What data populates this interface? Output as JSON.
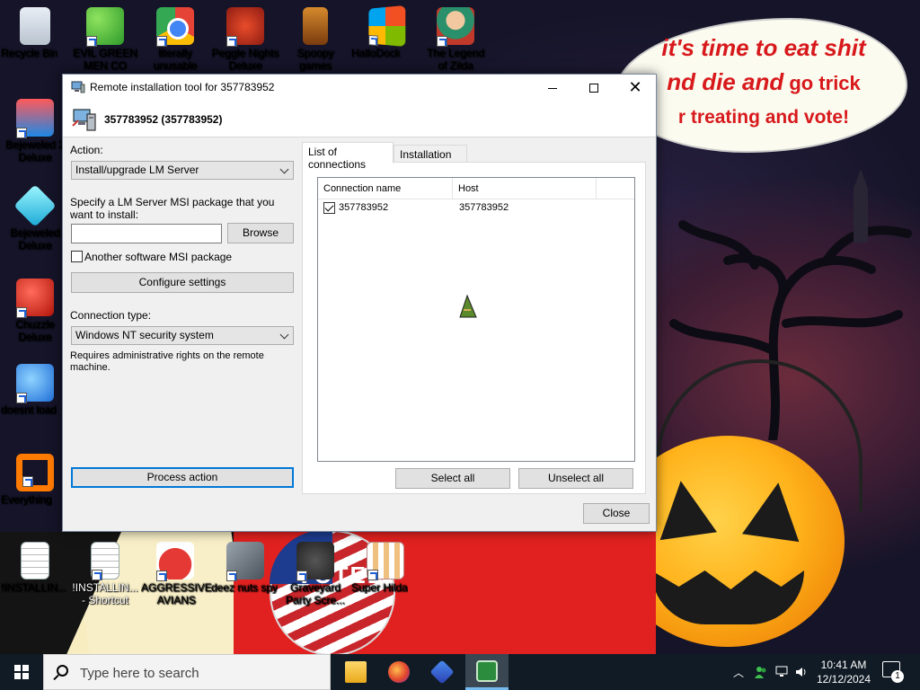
{
  "desktop": {
    "speech_bubble": {
      "line1": "it's time to eat shit",
      "line2_a": "nd die and",
      "line2_b": " go trick",
      "line3": "r treating and vote!"
    },
    "icons_top": [
      {
        "label": "Recycle Bin",
        "icon": "recycle-bin-icon"
      },
      {
        "label": "EVIL GREEN MEN CO",
        "icon": "msn-people-icon"
      },
      {
        "label": "literally unusable",
        "icon": "chrome-icon"
      },
      {
        "label": "Peggle Nights Deluxe",
        "icon": "peggle-icon"
      },
      {
        "label": "Spoopy games",
        "icon": "spoopy-folder-icon"
      },
      {
        "label": "HalloDock",
        "icon": "windows-logo-icon"
      },
      {
        "label": "The Legend of Zilda",
        "icon": "zilda-icon"
      }
    ],
    "icons_left": [
      {
        "label": "Bejeweled 2 Deluxe",
        "icon": "bejeweled-2-icon"
      },
      {
        "label": "Bejeweled Deluxe",
        "icon": "bejeweled-icon"
      },
      {
        "label": "Chuzzle Deluxe",
        "icon": "chuzzle-icon"
      },
      {
        "label": "doesnt load",
        "icon": "thunderbird-icon"
      },
      {
        "label": "Everything",
        "icon": "everything-search-icon"
      }
    ],
    "icons_bottom": [
      {
        "label": "!INSTALLIN...",
        "icon": "text-document-icon"
      },
      {
        "label": "!INSTALLIN... - Shortcut",
        "icon": "text-document-shortcut-icon"
      },
      {
        "label": "AGGRESSIVE AVIANS",
        "icon": "angry-bird-icon"
      },
      {
        "label": "deez nuts spy",
        "icon": "stacked-windows-icon"
      },
      {
        "label": "Graveyard Party Scre...",
        "icon": "graveyard-icon"
      },
      {
        "label": "Super Hilda",
        "icon": "pixel-dog-icon"
      }
    ],
    "background_text": "VOTED"
  },
  "dialog": {
    "title": "Remote installation tool for 357783952",
    "header": "357783952 (357783952)",
    "action_label": "Action:",
    "action_value": "Install/upgrade LM Server",
    "msi_label": "Specify a LM Server MSI package that you want to install:",
    "msi_path_value": "",
    "browse_label": "Browse",
    "another_msi_label": "Another software MSI package",
    "another_msi_checked": false,
    "configure_label": "Configure settings",
    "connection_type_label": "Connection type:",
    "connection_type_value": "Windows NT security system",
    "requires_note": "Requires administrative rights on the remote machine.",
    "process_label": "Process action",
    "tabs": [
      {
        "label": "List of connections",
        "active": true
      },
      {
        "label": "Installation log",
        "active": false
      }
    ],
    "columns": [
      "Connection name",
      "Host"
    ],
    "rows": [
      {
        "checked": true,
        "connection_name": "357783952",
        "host": "357783952"
      }
    ],
    "select_all_label": "Select all",
    "unselect_all_label": "Unselect all",
    "close_label": "Close"
  },
  "taskbar": {
    "search_placeholder": "Type here to search",
    "apps": [
      "file-explorer-icon",
      "firefox-icon",
      "edge-icon",
      "lm-server-icon"
    ],
    "time": "10:41 AM",
    "date": "12/12/2024",
    "notification_count": "1"
  },
  "colors": {
    "accent_focus": "#0078d7",
    "taskbar_bg": "#101b25",
    "speech_text": "#d8191c"
  }
}
